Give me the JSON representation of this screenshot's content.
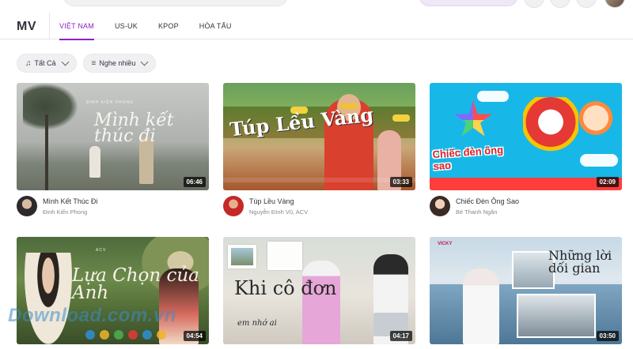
{
  "header": {
    "title": "MV",
    "tabs": [
      {
        "label": "VIỆT NAM",
        "active": true
      },
      {
        "label": "US-UK",
        "active": false
      },
      {
        "label": "KPOP",
        "active": false
      },
      {
        "label": "HÒA TẤU",
        "active": false
      }
    ]
  },
  "filters": {
    "genre": {
      "label": "Tất Cả",
      "icon": "music-note-icon"
    },
    "sort": {
      "label": "Nghe nhiều",
      "icon": "sort-icon"
    }
  },
  "videos": [
    {
      "title": "Mình Kết Thúc Đi",
      "artist": "Đinh Kiến Phong",
      "duration": "06:46",
      "thumb_text": "Mình kết thúc đi",
      "thumb_small": "ĐINH KIẾN PHONG"
    },
    {
      "title": "Túp Lều Vàng",
      "artist": "Nguyễn Đình Vũ, ACV",
      "duration": "03:33",
      "thumb_text": "Túp Lều Vàng"
    },
    {
      "title": "Chiếc Đèn Ông Sao",
      "artist": "Bé Thanh Ngân",
      "duration": "02:09",
      "thumb_text": "Chiếc đèn ông sao"
    },
    {
      "title": "",
      "artist": "",
      "duration": "04:54",
      "thumb_text": "Lựa Chọn của Anh",
      "thumb_small": "ACV"
    },
    {
      "title": "",
      "artist": "",
      "duration": "04:17",
      "thumb_text": "Khi cô đơn",
      "thumb_sub": "em nhớ ai"
    },
    {
      "title": "",
      "artist": "",
      "duration": "03:50",
      "thumb_text": "Những lời dối gian",
      "thumb_small": "VICKY"
    }
  ],
  "watermark": {
    "text": "Download.com.vn"
  },
  "colors": {
    "accent": "#8d22c3",
    "text": "#32323d",
    "muted": "#888891"
  }
}
